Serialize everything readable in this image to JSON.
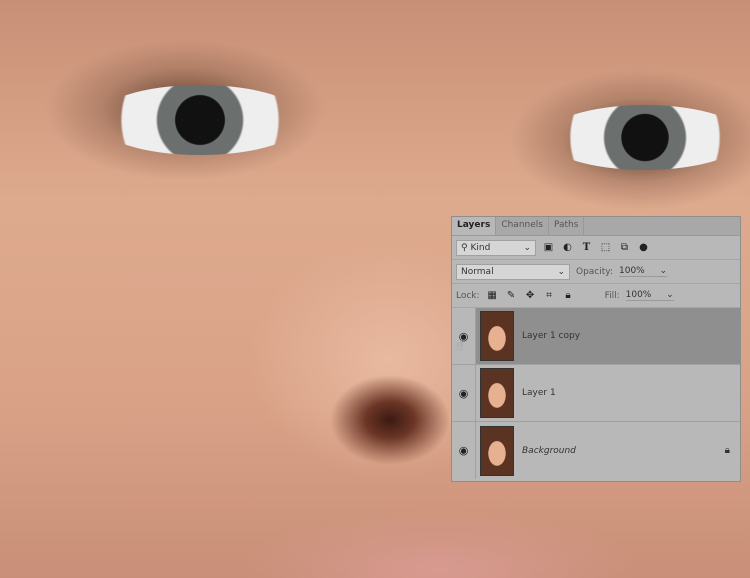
{
  "tabs": [
    "Layers",
    "Channels",
    "Paths"
  ],
  "filter": {
    "label": "Kind"
  },
  "blend": {
    "mode": "Normal",
    "opacity_label": "Opacity:",
    "opacity": "100%"
  },
  "lock": {
    "label": "Lock:",
    "fill_label": "Fill:",
    "fill": "100%"
  },
  "layers": [
    {
      "name": "Layer 1 copy",
      "selected": true
    },
    {
      "name": "Layer 1"
    },
    {
      "name": "Background",
      "locked": true
    }
  ]
}
